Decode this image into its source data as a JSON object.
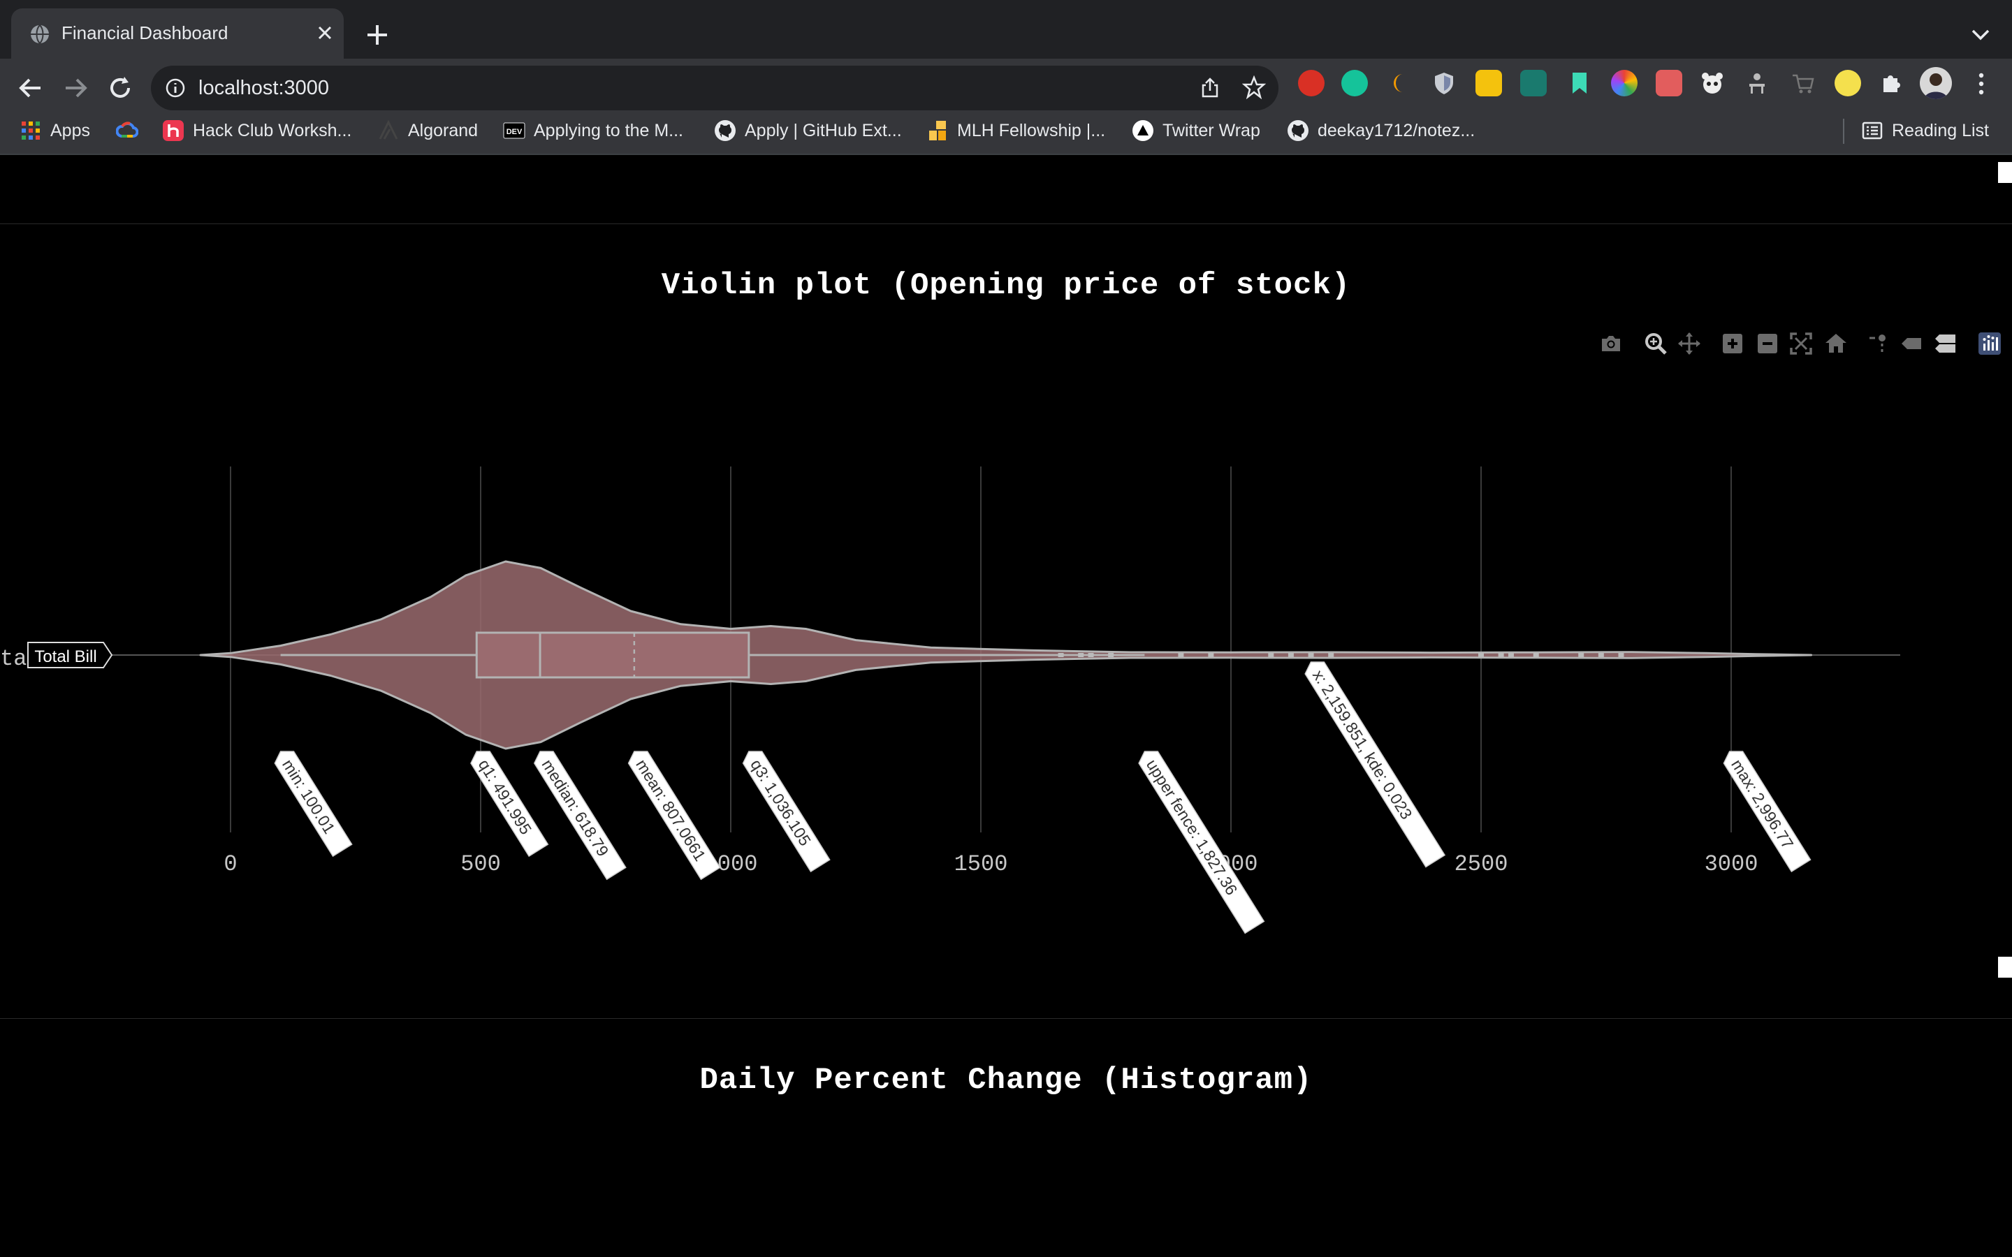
{
  "browser": {
    "tab_title": "Financial Dashboard",
    "url": "localhost:3000",
    "bookmarks": [
      {
        "label": "Apps",
        "icon": "apps-grid-icon"
      },
      {
        "label": "",
        "icon": "google-cloud-icon"
      },
      {
        "label": "Hack Club Worksh...",
        "icon": "hackclub-icon"
      },
      {
        "label": "Algorand",
        "icon": "algorand-icon"
      },
      {
        "label": "Applying to the M...",
        "icon": "dev-icon"
      },
      {
        "label": "Apply | GitHub Ext...",
        "icon": "github-icon"
      },
      {
        "label": "MLH Fellowship |...",
        "icon": "mlh-icon"
      },
      {
        "label": "Twitter Wrap",
        "icon": "triangle-icon"
      },
      {
        "label": "deekay1712/notez...",
        "icon": "github-icon"
      }
    ],
    "reading_list": "Reading List"
  },
  "page": {
    "violin_title": "Violin plot (Opening price of stock)",
    "histogram_title": "Daily Percent Change (Histogram)"
  },
  "chart_data": {
    "type": "violin",
    "title": "Violin plot (Opening price of stock)",
    "orientation": "horizontal",
    "trace_name": "Total Bill",
    "xlim": [
      -130,
      3335
    ],
    "x_ticks": [
      0,
      500,
      1000,
      1500,
      2000,
      2500,
      3000
    ],
    "x_tick_labels": [
      "0",
      "500",
      "1000",
      "1500",
      "2000",
      "2500",
      "3000"
    ],
    "fill_color": "#9a6b6f",
    "line_color": "#b3b3b3",
    "stats": {
      "min": 100.01,
      "q1": 491.995,
      "median": 618.79,
      "mean": 807.0661,
      "q3": 1036.105,
      "upper_fence": 1827.36,
      "max": 2996.77
    },
    "density_profile": [
      [
        -60,
        0.0
      ],
      [
        0,
        0.02
      ],
      [
        100,
        0.1
      ],
      [
        200,
        0.22
      ],
      [
        300,
        0.38
      ],
      [
        400,
        0.62
      ],
      [
        470,
        0.85
      ],
      [
        550,
        1.0
      ],
      [
        620,
        0.93
      ],
      [
        700,
        0.72
      ],
      [
        800,
        0.47
      ],
      [
        900,
        0.33
      ],
      [
        1000,
        0.28
      ],
      [
        1080,
        0.31
      ],
      [
        1150,
        0.28
      ],
      [
        1250,
        0.16
      ],
      [
        1400,
        0.08
      ],
      [
        1600,
        0.05
      ],
      [
        1800,
        0.03
      ],
      [
        2000,
        0.028
      ],
      [
        2200,
        0.03
      ],
      [
        2400,
        0.025
      ],
      [
        2600,
        0.028
      ],
      [
        2800,
        0.032
      ],
      [
        2950,
        0.02
      ],
      [
        3050,
        0.01
      ],
      [
        3160,
        0.0
      ]
    ],
    "hover_labels": [
      {
        "text": "min: 100.01",
        "x": 100.01
      },
      {
        "text": "q1: 491.995",
        "x": 491.995
      },
      {
        "text": "median: 618.79",
        "x": 618.79
      },
      {
        "text": "mean: 807.0661",
        "x": 807.0661
      },
      {
        "text": "q3: 1,036.105",
        "x": 1036.105
      },
      {
        "text": "upper fence: 1,827.36",
        "x": 1827.36
      },
      {
        "text": "x: 2,159.851, kde: 0.023",
        "x": 2159.851
      },
      {
        "text": "max: 2,996.77",
        "x": 2996.77
      }
    ],
    "y_label_fragment": "ta"
  }
}
